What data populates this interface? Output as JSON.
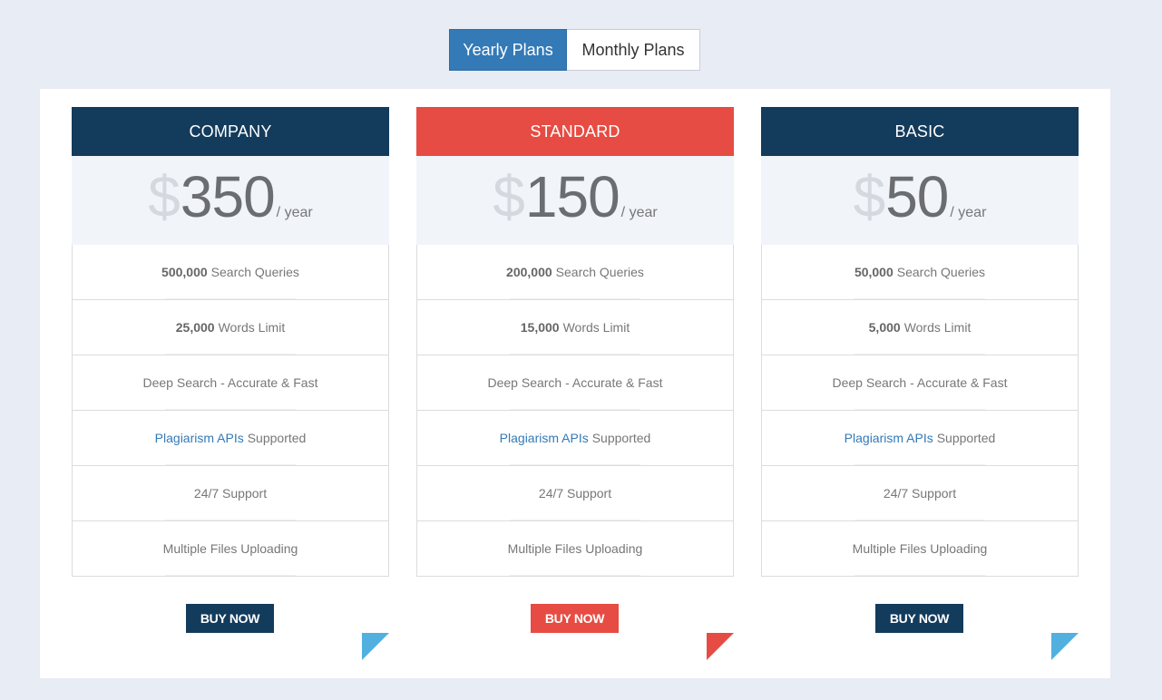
{
  "toggle": {
    "yearly_label": "Yearly Plans",
    "monthly_label": "Monthly Plans",
    "active": "yearly"
  },
  "colors": {
    "navy": "#133b5c",
    "red": "#e64c43",
    "blue_accent": "#337ab7",
    "corner_blue": "#52b0e0"
  },
  "plans": [
    {
      "name": "COMPANY",
      "currency": "$",
      "amount": "350",
      "period": "/ year",
      "features": {
        "queries_value": "500,000",
        "queries_label": "Search Queries",
        "words_value": "25,000",
        "words_label": "Words Limit",
        "deep_search": "Deep Search - Accurate & Fast",
        "api_link": "Plagiarism APIs",
        "api_label": "Supported",
        "support": "24/7 Support",
        "uploading": "Multiple Files Uploading"
      },
      "buy_label": "BUY NOW"
    },
    {
      "name": "STANDARD",
      "currency": "$",
      "amount": "150",
      "period": "/ year",
      "features": {
        "queries_value": "200,000",
        "queries_label": "Search Queries",
        "words_value": "15,000",
        "words_label": "Words Limit",
        "deep_search": "Deep Search - Accurate & Fast",
        "api_link": "Plagiarism APIs",
        "api_label": "Supported",
        "support": "24/7 Support",
        "uploading": "Multiple Files Uploading"
      },
      "buy_label": "BUY NOW"
    },
    {
      "name": "BASIC",
      "currency": "$",
      "amount": "50",
      "period": "/ year",
      "features": {
        "queries_value": "50,000",
        "queries_label": "Search Queries",
        "words_value": "5,000",
        "words_label": "Words Limit",
        "deep_search": "Deep Search - Accurate & Fast",
        "api_link": "Plagiarism APIs",
        "api_label": "Supported",
        "support": "24/7 Support",
        "uploading": "Multiple Files Uploading"
      },
      "buy_label": "BUY NOW"
    }
  ]
}
